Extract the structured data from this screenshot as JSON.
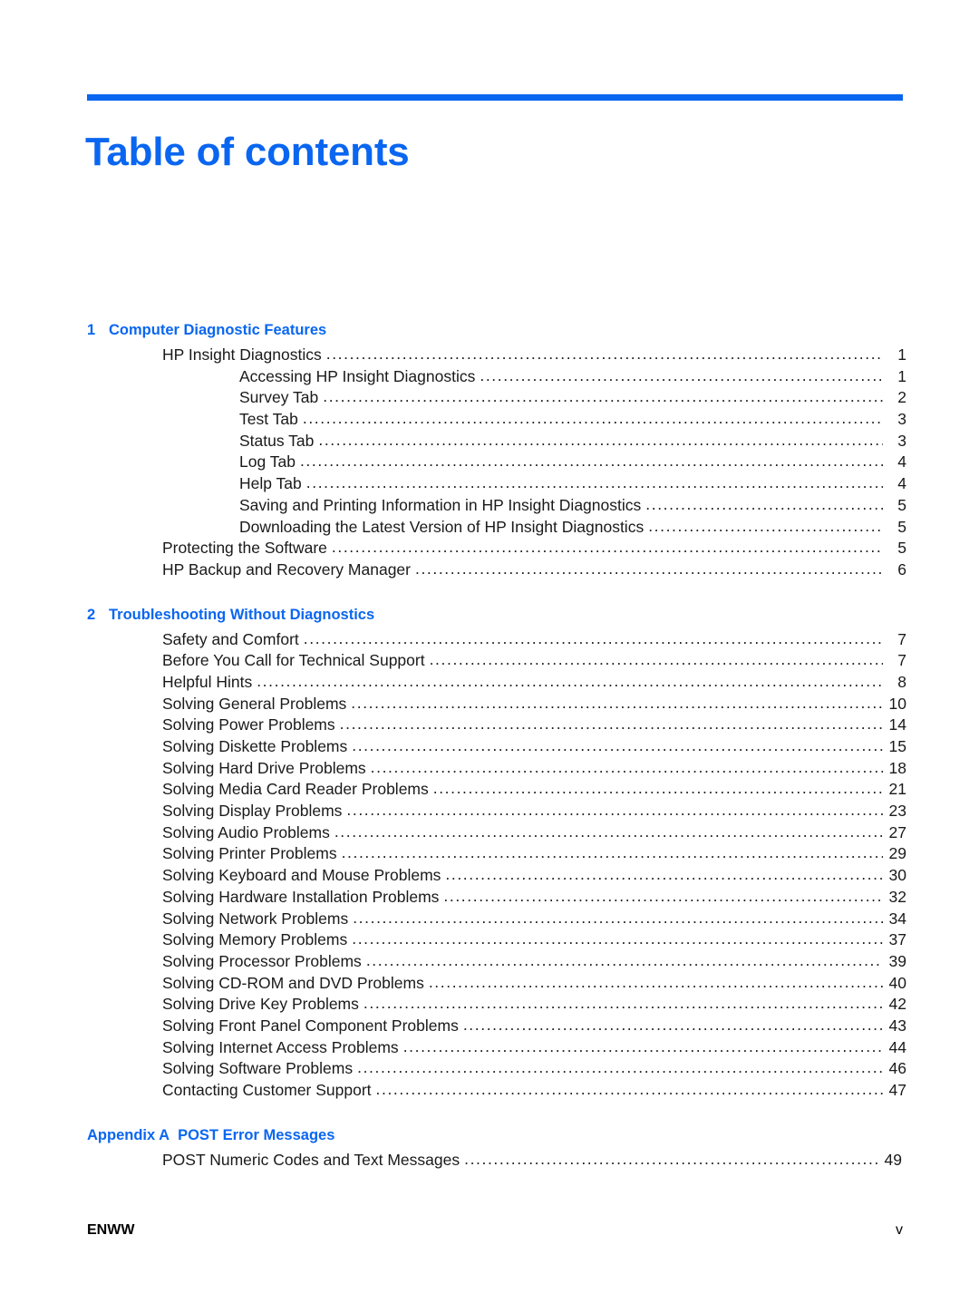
{
  "document": {
    "title": "Table of contents",
    "accent_color": "#0a66f0",
    "text_color": "#1a1a1a"
  },
  "footer": {
    "left": "ENWW",
    "right": "v"
  },
  "toc": {
    "chapters": [
      {
        "number": "1",
        "title": "Computer Diagnostic Features",
        "entries": [
          {
            "level": 1,
            "label": "HP Insight Diagnostics",
            "page": "1"
          },
          {
            "level": 2,
            "label": "Accessing HP Insight Diagnostics",
            "page": "1"
          },
          {
            "level": 2,
            "label": "Survey Tab",
            "page": "2"
          },
          {
            "level": 2,
            "label": "Test Tab",
            "page": "3"
          },
          {
            "level": 2,
            "label": "Status Tab",
            "page": "3"
          },
          {
            "level": 2,
            "label": "Log Tab",
            "page": "4"
          },
          {
            "level": 2,
            "label": "Help Tab",
            "page": "4"
          },
          {
            "level": 2,
            "label": "Saving and Printing Information in HP Insight Diagnostics",
            "page": "5"
          },
          {
            "level": 2,
            "label": "Downloading the Latest Version of HP Insight Diagnostics",
            "page": "5"
          },
          {
            "level": 1,
            "label": "Protecting the Software",
            "page": "5"
          },
          {
            "level": 1,
            "label": "HP Backup and Recovery Manager",
            "page": "6"
          }
        ]
      },
      {
        "number": "2",
        "title": "Troubleshooting Without Diagnostics",
        "entries": [
          {
            "level": 1,
            "label": "Safety and Comfort",
            "page": "7"
          },
          {
            "level": 1,
            "label": "Before You Call for Technical Support",
            "page": "7"
          },
          {
            "level": 1,
            "label": "Helpful Hints",
            "page": "8"
          },
          {
            "level": 1,
            "label": "Solving General Problems",
            "page": "10"
          },
          {
            "level": 1,
            "label": "Solving Power Problems",
            "page": "14"
          },
          {
            "level": 1,
            "label": "Solving Diskette Problems",
            "page": "15"
          },
          {
            "level": 1,
            "label": "Solving Hard Drive Problems",
            "page": "18"
          },
          {
            "level": 1,
            "label": "Solving Media Card Reader Problems",
            "page": "21"
          },
          {
            "level": 1,
            "label": "Solving Display Problems",
            "page": "23"
          },
          {
            "level": 1,
            "label": "Solving Audio Problems",
            "page": "27"
          },
          {
            "level": 1,
            "label": "Solving Printer Problems",
            "page": "29"
          },
          {
            "level": 1,
            "label": "Solving Keyboard and Mouse Problems",
            "page": "30"
          },
          {
            "level": 1,
            "label": "Solving Hardware Installation Problems",
            "page": "32"
          },
          {
            "level": 1,
            "label": "Solving Network Problems",
            "page": "34"
          },
          {
            "level": 1,
            "label": "Solving Memory Problems",
            "page": "37"
          },
          {
            "level": 1,
            "label": "Solving Processor Problems",
            "page": "39"
          },
          {
            "level": 1,
            "label": "Solving CD-ROM and DVD Problems",
            "page": "40"
          },
          {
            "level": 1,
            "label": "Solving Drive Key Problems",
            "page": "42"
          },
          {
            "level": 1,
            "label": "Solving Front Panel Component Problems",
            "page": "43"
          },
          {
            "level": 1,
            "label": "Solving Internet Access Problems",
            "page": "44"
          },
          {
            "level": 1,
            "label": "Solving Software Problems",
            "page": "46"
          },
          {
            "level": 1,
            "label": "Contacting Customer Support",
            "page": "47"
          }
        ]
      },
      {
        "number": "Appendix A",
        "title": "POST Error Messages",
        "appendix": true,
        "entries": [
          {
            "level": 1,
            "label": "POST Numeric Codes and Text Messages",
            "page": "49",
            "narrow": true
          }
        ]
      }
    ]
  }
}
